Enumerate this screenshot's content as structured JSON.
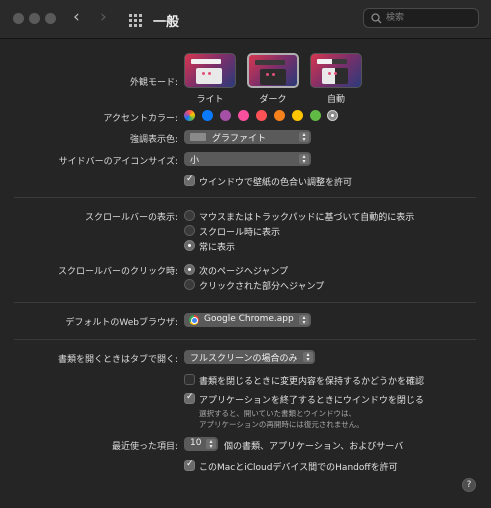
{
  "header": {
    "title": "一般",
    "search_placeholder": "検索",
    "back_icon": "chevron-left-icon",
    "forward_icon": "chevron-right-icon",
    "grid_icon": "grid-icon"
  },
  "appearance": {
    "label": "外観モード:",
    "options": [
      "ライト",
      "ダーク",
      "自動"
    ],
    "selected": "ダーク"
  },
  "accent": {
    "label": "アクセントカラー:",
    "colors": [
      "multicolor",
      "#0a7aff",
      "#a550a7",
      "#f74f9e",
      "#ff5257",
      "#f7821b",
      "#ffc600",
      "#62ba46",
      "#8c8c8c"
    ],
    "selected_index": 8
  },
  "highlight": {
    "label": "強調表示色:",
    "value": "グラファイト"
  },
  "sidebar_icon_size": {
    "label": "サイドバーのアイコンサイズ:",
    "value": "小"
  },
  "wallpaper_tint": {
    "label": "ウインドウで壁紙の色合い調整を許可",
    "checked": true
  },
  "scrollbars_show": {
    "label": "スクロールバーの表示:",
    "options": [
      "マウスまたはトラックパッドに基づいて自動的に表示",
      "スクロール時に表示",
      "常に表示"
    ],
    "selected_index": 2
  },
  "scrollbar_click": {
    "label": "スクロールバーのクリック時:",
    "options": [
      "次のページへジャンプ",
      "クリックされた部分へジャンプ"
    ],
    "selected_index": 0
  },
  "browser": {
    "label": "デフォルトのWebブラウザ:",
    "value": "Google Chrome.app"
  },
  "tabs": {
    "label": "書類を開くときはタブで開く:",
    "value": "フルスクリーンの場合のみ"
  },
  "ask_save": {
    "label": "書類を閉じるときに変更内容を保持するかどうかを確認",
    "checked": false
  },
  "close_windows": {
    "label": "アプリケーションを終了するときにウインドウを閉じる",
    "checked": true,
    "note_line1": "選択すると、開いていた書類とウインドウは、",
    "note_line2": "アプリケーションの再開時には復元されません。"
  },
  "recent": {
    "label": "最近使った項目:",
    "value": "10",
    "suffix": "個の書類、アプリケーション、およびサーバ"
  },
  "handoff": {
    "label": "このMacとiCloudデバイス間でのHandoffを許可",
    "checked": true
  },
  "help": {
    "label": "?"
  }
}
